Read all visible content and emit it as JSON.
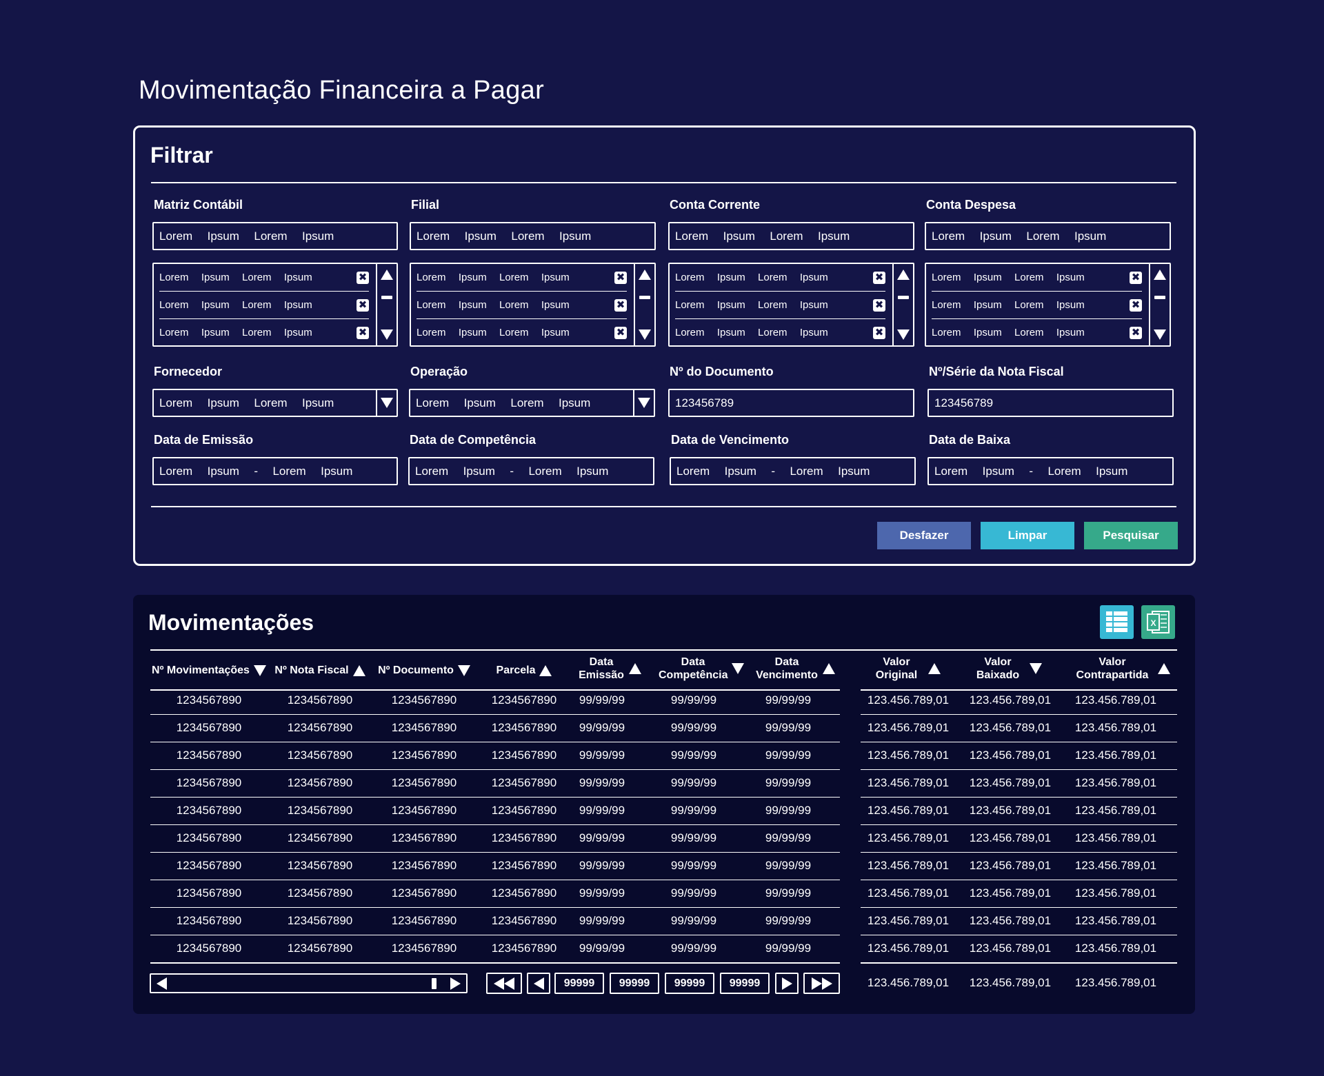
{
  "page": {
    "title": "Movimentação Financeira a Pagar"
  },
  "filter": {
    "title": "Filtrar",
    "columns": [
      {
        "label": "Matriz Contábil",
        "input": "Lorem  Ipsum  Lorem  Ipsum",
        "list": [
          "Lorem  Ipsum  Lorem  Ipsum",
          "Lorem  Ipsum  Lorem  Ipsum",
          "Lorem  Ipsum  Lorem  Ipsum"
        ]
      },
      {
        "label": "Filial",
        "input": "Lorem  Ipsum  Lorem  Ipsum",
        "list": [
          "Lorem  Ipsum  Lorem  Ipsum",
          "Lorem  Ipsum  Lorem  Ipsum",
          "Lorem  Ipsum  Lorem  Ipsum"
        ]
      },
      {
        "label": "Conta Corrente",
        "input": "Lorem  Ipsum  Lorem  Ipsum",
        "list": [
          "Lorem  Ipsum  Lorem  Ipsum",
          "Lorem  Ipsum  Lorem  Ipsum",
          "Lorem  Ipsum  Lorem  Ipsum"
        ]
      },
      {
        "label": "Conta Despesa",
        "input": "Lorem  Ipsum  Lorem  Ipsum",
        "list": [
          "Lorem  Ipsum  Lorem  Ipsum",
          "Lorem  Ipsum  Lorem  Ipsum",
          "Lorem  Ipsum  Lorem  Ipsum"
        ]
      }
    ],
    "fornecedor": {
      "label": "Fornecedor",
      "value": "Lorem  Ipsum  Lorem  Ipsum"
    },
    "operacao": {
      "label": "Operação",
      "value": "Lorem  Ipsum  Lorem  Ipsum"
    },
    "documento": {
      "label": "Nº do Documento",
      "value": "123456789"
    },
    "nota_fiscal": {
      "label": "Nº/Série da Nota Fiscal",
      "value": "123456789"
    },
    "data_emissao": {
      "label": "Data de Emissão",
      "value": "Lorem  Ipsum  -  Lorem  Ipsum"
    },
    "data_competencia": {
      "label": "Data de Competência",
      "value": "Lorem  Ipsum  -  Lorem  Ipsum"
    },
    "data_vencimento": {
      "label": "Data de Vencimento",
      "value": "Lorem  Ipsum  -  Lorem  Ipsum"
    },
    "data_baixa": {
      "label": "Data de Baixa",
      "value": "Lorem  Ipsum  -  Lorem  Ipsum"
    },
    "buttons": {
      "desfazer": "Desfazer",
      "limpar": "Limpar",
      "pesquisar": "Pesquisar"
    },
    "icons": {
      "remove": "close-square-icon",
      "scroll_up": "triangle-up-icon",
      "scroll_down": "triangle-down-icon",
      "dropdown": "triangle-down-icon"
    }
  },
  "results": {
    "title": "Movimentações",
    "icons": {
      "grid": "grid-view-icon",
      "excel": "excel-export-icon"
    },
    "columns": [
      {
        "label": "Nº Movimentações",
        "sort": "desc"
      },
      {
        "label": "Nº Nota Fiscal",
        "sort": "asc"
      },
      {
        "label": "Nº Documento",
        "sort": "desc"
      },
      {
        "label": "Parcela",
        "sort": "asc"
      },
      {
        "label": "Data Emissão",
        "sort": "asc"
      },
      {
        "label": "Data Competência",
        "sort": "desc"
      },
      {
        "label": "Data Vencimento",
        "sort": "asc"
      },
      {
        "label": "Valor Original",
        "sort": "asc"
      },
      {
        "label": "Valor Baixado",
        "sort": "desc"
      },
      {
        "label": "Valor Contrapartida",
        "sort": "asc"
      }
    ],
    "rows": [
      [
        "1234567890",
        "1234567890",
        "1234567890",
        "1234567890",
        "99/99/99",
        "99/99/99",
        "99/99/99",
        "123.456.789,01",
        "123.456.789,01",
        "123.456.789,01"
      ],
      [
        "1234567890",
        "1234567890",
        "1234567890",
        "1234567890",
        "99/99/99",
        "99/99/99",
        "99/99/99",
        "123.456.789,01",
        "123.456.789,01",
        "123.456.789,01"
      ],
      [
        "1234567890",
        "1234567890",
        "1234567890",
        "1234567890",
        "99/99/99",
        "99/99/99",
        "99/99/99",
        "123.456.789,01",
        "123.456.789,01",
        "123.456.789,01"
      ],
      [
        "1234567890",
        "1234567890",
        "1234567890",
        "1234567890",
        "99/99/99",
        "99/99/99",
        "99/99/99",
        "123.456.789,01",
        "123.456.789,01",
        "123.456.789,01"
      ],
      [
        "1234567890",
        "1234567890",
        "1234567890",
        "1234567890",
        "99/99/99",
        "99/99/99",
        "99/99/99",
        "123.456.789,01",
        "123.456.789,01",
        "123.456.789,01"
      ],
      [
        "1234567890",
        "1234567890",
        "1234567890",
        "1234567890",
        "99/99/99",
        "99/99/99",
        "99/99/99",
        "123.456.789,01",
        "123.456.789,01",
        "123.456.789,01"
      ],
      [
        "1234567890",
        "1234567890",
        "1234567890",
        "1234567890",
        "99/99/99",
        "99/99/99",
        "99/99/99",
        "123.456.789,01",
        "123.456.789,01",
        "123.456.789,01"
      ],
      [
        "1234567890",
        "1234567890",
        "1234567890",
        "1234567890",
        "99/99/99",
        "99/99/99",
        "99/99/99",
        "123.456.789,01",
        "123.456.789,01",
        "123.456.789,01"
      ],
      [
        "1234567890",
        "1234567890",
        "1234567890",
        "1234567890",
        "99/99/99",
        "99/99/99",
        "99/99/99",
        "123.456.789,01",
        "123.456.789,01",
        "123.456.789,01"
      ],
      [
        "1234567890",
        "1234567890",
        "1234567890",
        "1234567890",
        "99/99/99",
        "99/99/99",
        "99/99/99",
        "123.456.789,01",
        "123.456.789,01",
        "123.456.789,01"
      ]
    ],
    "totals": [
      "123.456.789,01",
      "123.456.789,01",
      "123.456.789,01"
    ],
    "pagination": {
      "pages": [
        "99999",
        "99999",
        "99999",
        "99999"
      ],
      "icons": [
        "first-page-icon",
        "prev-page-icon",
        "next-page-icon",
        "last-page-icon"
      ]
    }
  }
}
